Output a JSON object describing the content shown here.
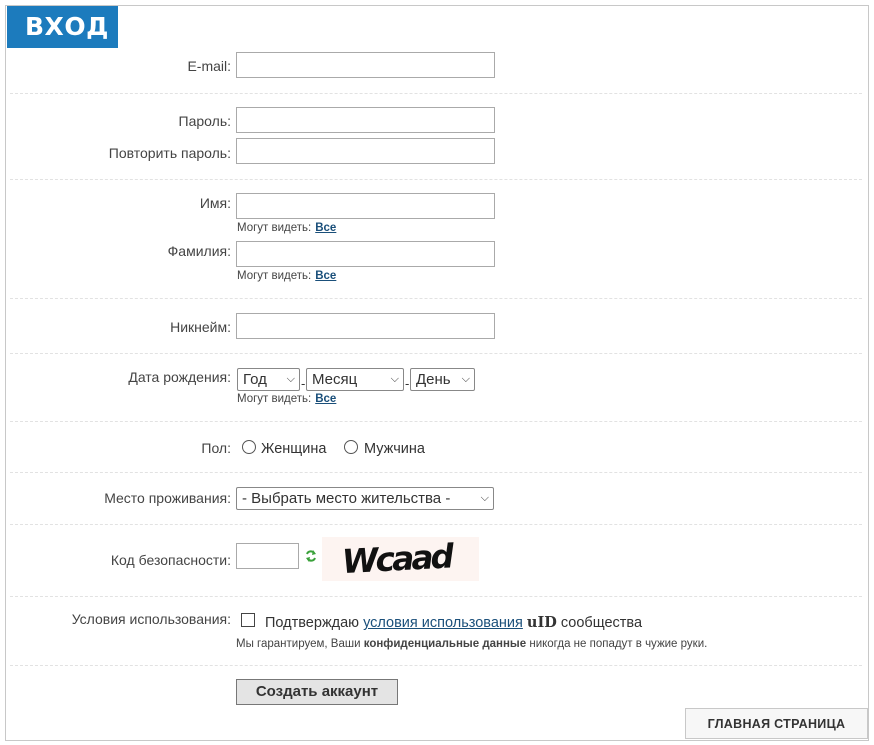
{
  "header": {
    "title": "ВХОД"
  },
  "fields": {
    "email": {
      "label": "E-mail:",
      "value": ""
    },
    "password": {
      "label": "Пароль:",
      "value": ""
    },
    "password_repeat": {
      "label": "Повторить пароль:",
      "value": ""
    },
    "first_name": {
      "label": "Имя:",
      "value": "",
      "visibility_label": "Могут видеть:",
      "visibility_value": "Все"
    },
    "last_name": {
      "label": "Фамилия:",
      "value": "",
      "visibility_label": "Могут видеть:",
      "visibility_value": "Все"
    },
    "nickname": {
      "label": "Никнейм:",
      "value": ""
    },
    "birthdate": {
      "label": "Дата рождения:",
      "year": "Год",
      "month": "Месяц",
      "day": "День",
      "separator": "-",
      "visibility_label": "Могут видеть:",
      "visibility_value": "Все"
    },
    "gender": {
      "label": "Пол:",
      "options": [
        "Женщина",
        "Мужчина"
      ]
    },
    "location": {
      "label": "Место проживания:",
      "selected": "- Выбрать место жительства -"
    },
    "captcha": {
      "label": "Код безопасности:",
      "value": "",
      "image_text": "Wcaad"
    },
    "terms": {
      "label": "Условия использования:",
      "prefix": "Подтверждаю",
      "link": "условия использования",
      "brand": "uID",
      "suffix": "сообщества",
      "guarantee_prefix": "Мы гарантируем, Ваши",
      "guarantee_bold": "конфиденциальные данные",
      "guarantee_suffix": "никогда не попадут в чужие руки."
    }
  },
  "actions": {
    "submit_label": "Создать аккаунт",
    "home_label": "ГЛАВНАЯ СТРАНИЦА"
  },
  "colors": {
    "accent": "#1c7bbd",
    "link": "#1a4f7a",
    "refresh": "#3aa13a"
  },
  "icons": {
    "refresh": "refresh-icon",
    "dropdown": "chevron-down-icon"
  }
}
